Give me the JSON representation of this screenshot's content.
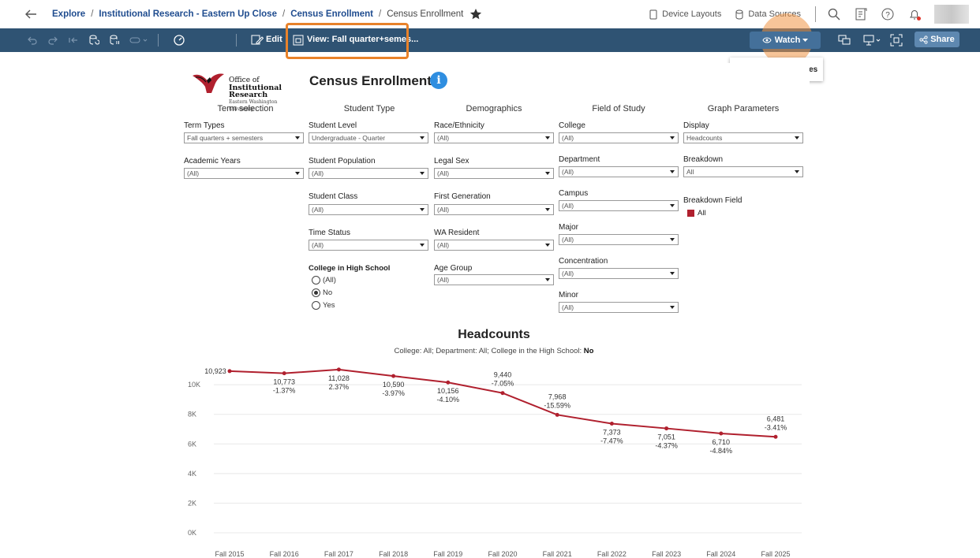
{
  "nav": {
    "crumbs": [
      "Explore",
      "Institutional Research - Eastern Up Close",
      "Census Enrollment",
      "Census Enrollment"
    ],
    "device_layouts": "Device Layouts",
    "data_sources": "Data Sources"
  },
  "toolbar": {
    "edit": "Edit",
    "view": "View: Fall quarter+semes...",
    "watch": "Watch",
    "share": "Share",
    "tooltip": "Keep track of updates"
  },
  "dashboard": {
    "logo_line1": "Office of",
    "logo_line2": "Institutional Research",
    "logo_line3": "Eastern Washington University",
    "title": "Census Enrollment",
    "info_icon_glyph": "i",
    "columns": [
      "Term selection",
      "Student Type",
      "Demographics",
      "Field of Study",
      "Graph Parameters"
    ],
    "filters": {
      "term_types": {
        "label": "Term Types",
        "value": "Fall quarters + semesters"
      },
      "academic_years": {
        "label": "Academic Years",
        "value": "(All)"
      },
      "student_level": {
        "label": "Student Level",
        "value": "Undergraduate - Quarter"
      },
      "student_population": {
        "label": "Student Population",
        "value": "(All)"
      },
      "student_class": {
        "label": "Student Class",
        "value": "(All)"
      },
      "time_status": {
        "label": "Time Status",
        "value": "(All)"
      },
      "race": {
        "label": "Race/Ethnicity",
        "value": "(All)"
      },
      "legal_sex": {
        "label": "Legal Sex",
        "value": "(All)"
      },
      "first_gen": {
        "label": "First Generation",
        "value": "(All)"
      },
      "wa_resident": {
        "label": "WA Resident",
        "value": "(All)"
      },
      "age_group": {
        "label": "Age Group",
        "value": "(All)"
      },
      "college": {
        "label": "College",
        "value": "(All)"
      },
      "department": {
        "label": "Department",
        "value": "(All)"
      },
      "campus": {
        "label": "Campus",
        "value": "(All)"
      },
      "major": {
        "label": "Major",
        "value": "(All)"
      },
      "concentration": {
        "label": "Concentration",
        "value": "(All)"
      },
      "minor": {
        "label": "Minor",
        "value": "(All)"
      },
      "display": {
        "label": "Display",
        "value": "Headcounts"
      },
      "breakdown": {
        "label": "Breakdown",
        "value": "All"
      },
      "breakdown_field": {
        "label": "Breakdown Field",
        "legend": "All"
      }
    },
    "chs": {
      "label": "College in High School",
      "options": [
        "(All)",
        "No",
        "Yes"
      ],
      "selected": "No"
    }
  },
  "chart_data": {
    "type": "line",
    "title": "Headcounts",
    "subtitle_prefix": "College: All; Department: All; College in the High School: ",
    "subtitle_value": "No",
    "categories": [
      "Fall 2015",
      "Fall 2016",
      "Fall 2017",
      "Fall 2018",
      "Fall 2019",
      "Fall 2020",
      "Fall 2021",
      "Fall 2022",
      "Fall 2023",
      "Fall 2024",
      "Fall 2025"
    ],
    "series": [
      {
        "values": [
          10923,
          10773,
          11028,
          10590,
          10156,
          9440,
          7968,
          7373,
          7051,
          6710,
          6481
        ],
        "value_labels": [
          "10,923",
          "10,773",
          "11,028",
          "10,590",
          "10,156",
          "9,440",
          "7,968",
          "7,373",
          "7,051",
          "6,710",
          "6,481"
        ],
        "pct_labels": [
          "",
          "-1.37%",
          "2.37%",
          "-3.97%",
          "-4.10%",
          "-7.05%",
          "-15.59%",
          "-7.47%",
          "-4.37%",
          "-4.84%",
          "-3.41%"
        ],
        "color": "#b0202e"
      }
    ],
    "y_ticks": [
      "0K",
      "2K",
      "4K",
      "6K",
      "8K",
      "10K"
    ],
    "ylim": [
      0,
      11500
    ],
    "grid": true
  }
}
